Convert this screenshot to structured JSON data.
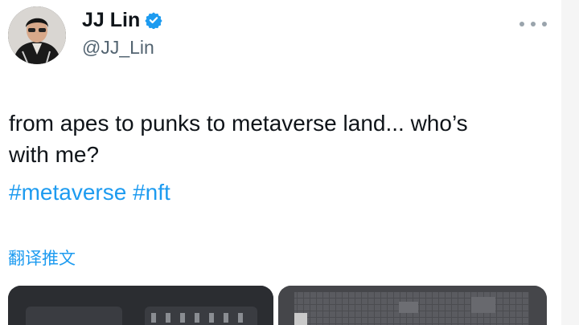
{
  "author": {
    "display_name": "JJ Lin",
    "handle": "@JJ_Lin",
    "verified": true,
    "avatar_icon": "profile-photo"
  },
  "menu": {
    "icon": "more-dots-icon"
  },
  "tweet": {
    "text_lines": [
      "from apes to punks to metaverse land... who’s",
      "with me?"
    ],
    "hashtags": [
      "#metaverse",
      "#nft"
    ]
  },
  "translate_label": "翻译推文",
  "media": {
    "count": 2,
    "icons": [
      "nft-image-1",
      "nft-image-2"
    ]
  },
  "colors": {
    "text": "#0f1419",
    "muted": "#536471",
    "accent": "#1d9bf0"
  }
}
